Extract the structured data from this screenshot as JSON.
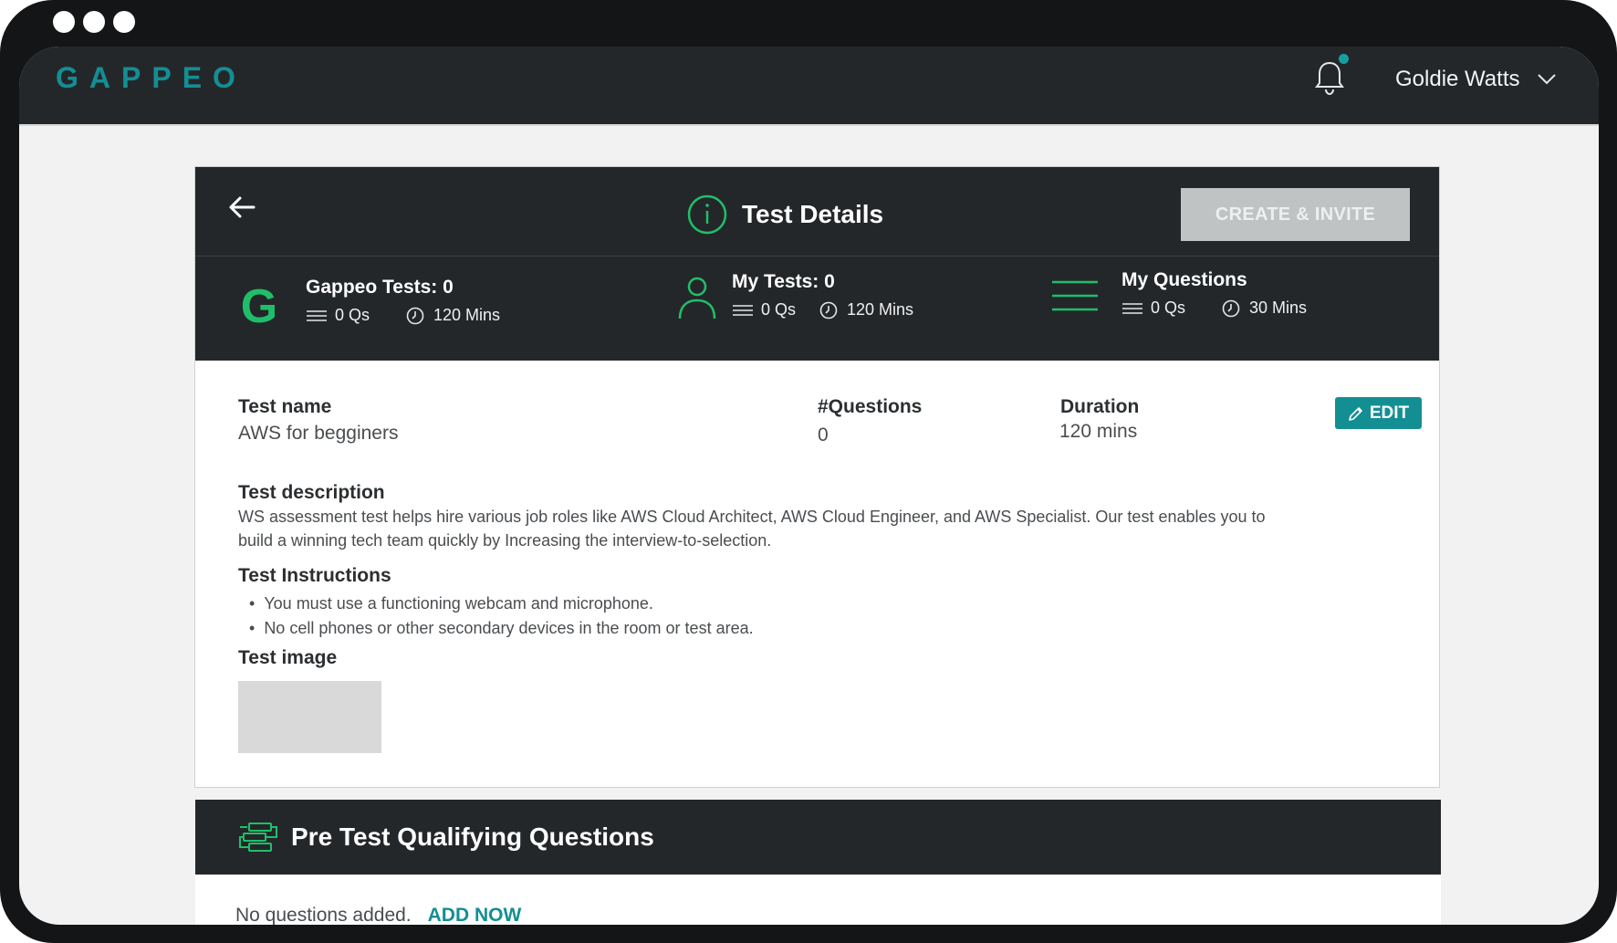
{
  "app": {
    "logo": "GAPPEO",
    "user_name": "Goldie Watts"
  },
  "colors": {
    "accent": "#138f94",
    "green": "#1fbf6a",
    "dark": "#24272a"
  },
  "header": {
    "title": "Test Details",
    "create_invite_label": "CREATE & INVITE"
  },
  "stats": [
    {
      "title": "Gappeo Tests: 0",
      "qs": "0 Qs",
      "mins": "120 Mins",
      "icon": "gappeo-g-icon"
    },
    {
      "title": "My Tests: 0",
      "qs": "0 Qs",
      "mins": "120 Mins",
      "icon": "user-icon"
    },
    {
      "title": "My Questions",
      "qs": "0 Qs",
      "mins": "30 Mins",
      "icon": "list-lines-icon"
    }
  ],
  "details": {
    "name_label": "Test name",
    "name_value": "AWS for begginers",
    "questions_label": "#Questions",
    "questions_value": "0",
    "duration_label": "Duration",
    "duration_value": "120 mins",
    "edit_label": "EDIT",
    "description_label": "Test description",
    "description": "WS assessment test helps hire various job roles like AWS Cloud Architect, AWS Cloud Engineer, and AWS Specialist. Our test enables you to build a winning tech team quickly by Increasing the interview-to-selection.",
    "instructions_label": "Test Instructions",
    "instructions": [
      "You must use a functioning webcam and microphone.",
      "No cell phones or other secondary devices in the room or test area."
    ],
    "image_label": "Test image"
  },
  "pre_test": {
    "title": "Pre Test Qualifying Questions",
    "empty_text": "No questions added.",
    "add_now_label": "ADD NOW"
  }
}
